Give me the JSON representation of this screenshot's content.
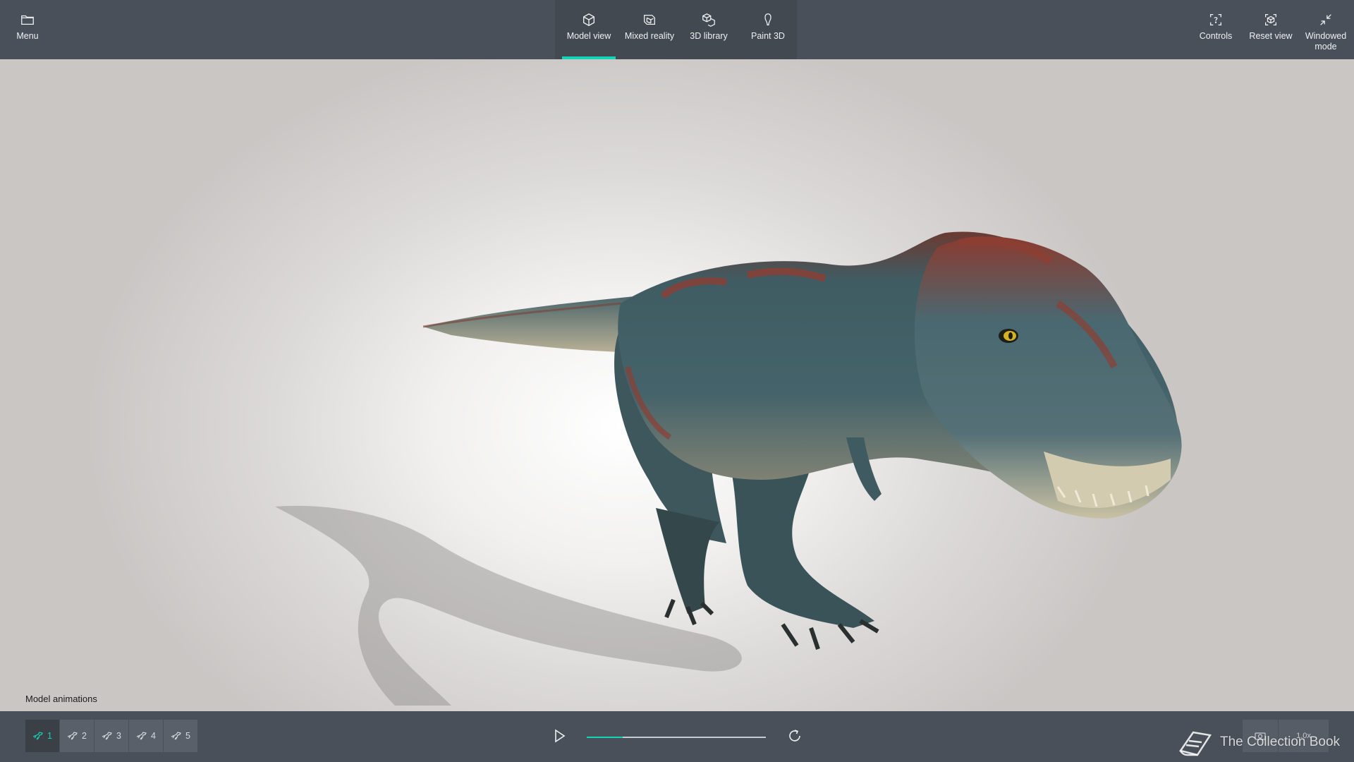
{
  "topbar": {
    "menu_label": "Menu",
    "tabs": [
      {
        "label": "Model view",
        "icon": "cube-icon",
        "active": true
      },
      {
        "label": "Mixed reality",
        "icon": "mixed-reality-icon",
        "active": false
      },
      {
        "label": "3D library",
        "icon": "library-icon",
        "active": false
      },
      {
        "label": "Paint 3D",
        "icon": "paint-3d-icon",
        "active": false
      }
    ],
    "right": {
      "controls_label": "Controls",
      "reset_label": "Reset view",
      "windowed_line1": "Windowed",
      "windowed_line2": "mode"
    }
  },
  "viewport": {
    "model": "t-rex-dinosaur"
  },
  "animations": {
    "title": "Model animations",
    "items": [
      {
        "label": "1",
        "active": true
      },
      {
        "label": "2",
        "active": false
      },
      {
        "label": "3",
        "active": false
      },
      {
        "label": "4",
        "active": false
      },
      {
        "label": "5",
        "active": false
      }
    ]
  },
  "playback": {
    "progress": 0.2,
    "speed": "1.0x"
  },
  "watermark": {
    "text": "The Collection Book"
  },
  "colors": {
    "accent": "#14d3b8",
    "bar": "#4a5059"
  }
}
